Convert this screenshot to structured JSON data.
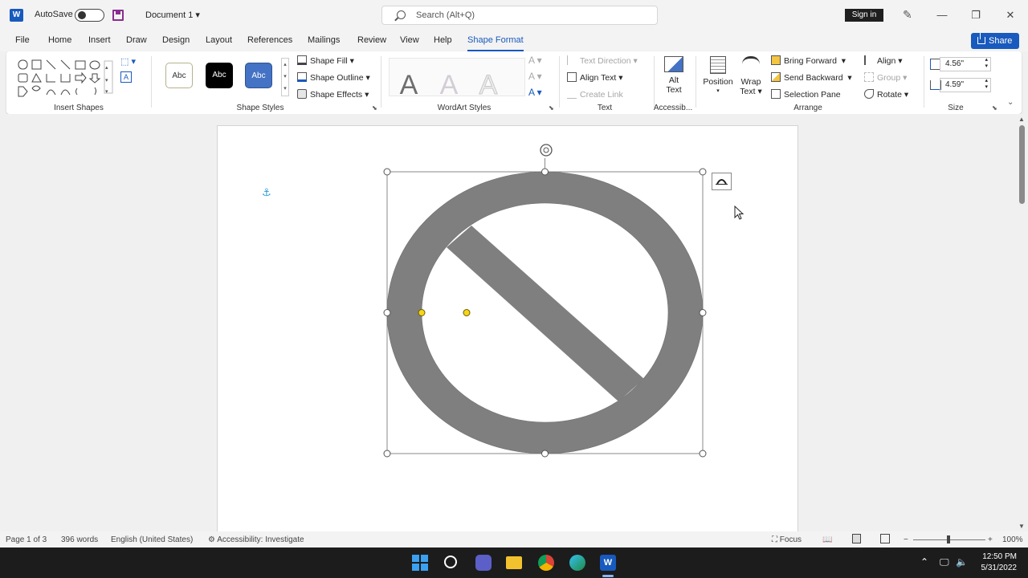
{
  "app": {
    "autosave_label": "AutoSave",
    "autosave_state": "Off",
    "document_title": "Document 1",
    "search_placeholder": "Search (Alt+Q)",
    "signin_label": "Sign in",
    "share_label": "Share",
    "window_controls": [
      "minimize-icon",
      "restore-icon",
      "close-icon"
    ]
  },
  "tabs": [
    {
      "label": "File"
    },
    {
      "label": "Home"
    },
    {
      "label": "Insert"
    },
    {
      "label": "Draw"
    },
    {
      "label": "Design"
    },
    {
      "label": "Layout"
    },
    {
      "label": "References"
    },
    {
      "label": "Mailings"
    },
    {
      "label": "Review"
    },
    {
      "label": "View"
    },
    {
      "label": "Help"
    },
    {
      "label": "Shape Format",
      "active": true
    }
  ],
  "ribbon": {
    "groups": {
      "insert_shapes": "Insert Shapes",
      "shape_styles": "Shape Styles",
      "wordart_styles": "WordArt Styles",
      "text": "Text",
      "accessibility": "Accessib...",
      "arrange": "Arrange",
      "size": "Size"
    },
    "style_swatches": [
      "Abc",
      "Abc",
      "Abc"
    ],
    "shape_fill": "Shape Fill",
    "shape_outline": "Shape Outline",
    "shape_effects": "Shape Effects",
    "wordart_letters": [
      "A",
      "A",
      "A"
    ],
    "text_direction": "Text Direction",
    "align_text": "Align Text",
    "create_link": "Create Link",
    "alt_text_line1": "Alt",
    "alt_text_line2": "Text",
    "position": "Position",
    "wrap_text_line1": "Wrap",
    "wrap_text_line2": "Text",
    "bring_forward": "Bring Forward",
    "send_backward": "Send Backward",
    "selection_pane": "Selection Pane",
    "align": "Align",
    "group": "Group",
    "rotate": "Rotate",
    "height_value": "4.56\"",
    "width_value": "4.59\""
  },
  "colors": {
    "accent": "#185abd",
    "shape_fill": "#7f7f7f",
    "handle_yellow": "#f5d617"
  },
  "status": {
    "page": "Page 1 of 3",
    "words": "396 words",
    "language": "English (United States)",
    "accessibility": "Accessibility: Investigate",
    "focus": "Focus",
    "zoom_minus": "−",
    "zoom_plus": "+",
    "zoom": "100%"
  },
  "taskbar": {
    "time": "12:50 PM",
    "date": "5/31/2022"
  }
}
